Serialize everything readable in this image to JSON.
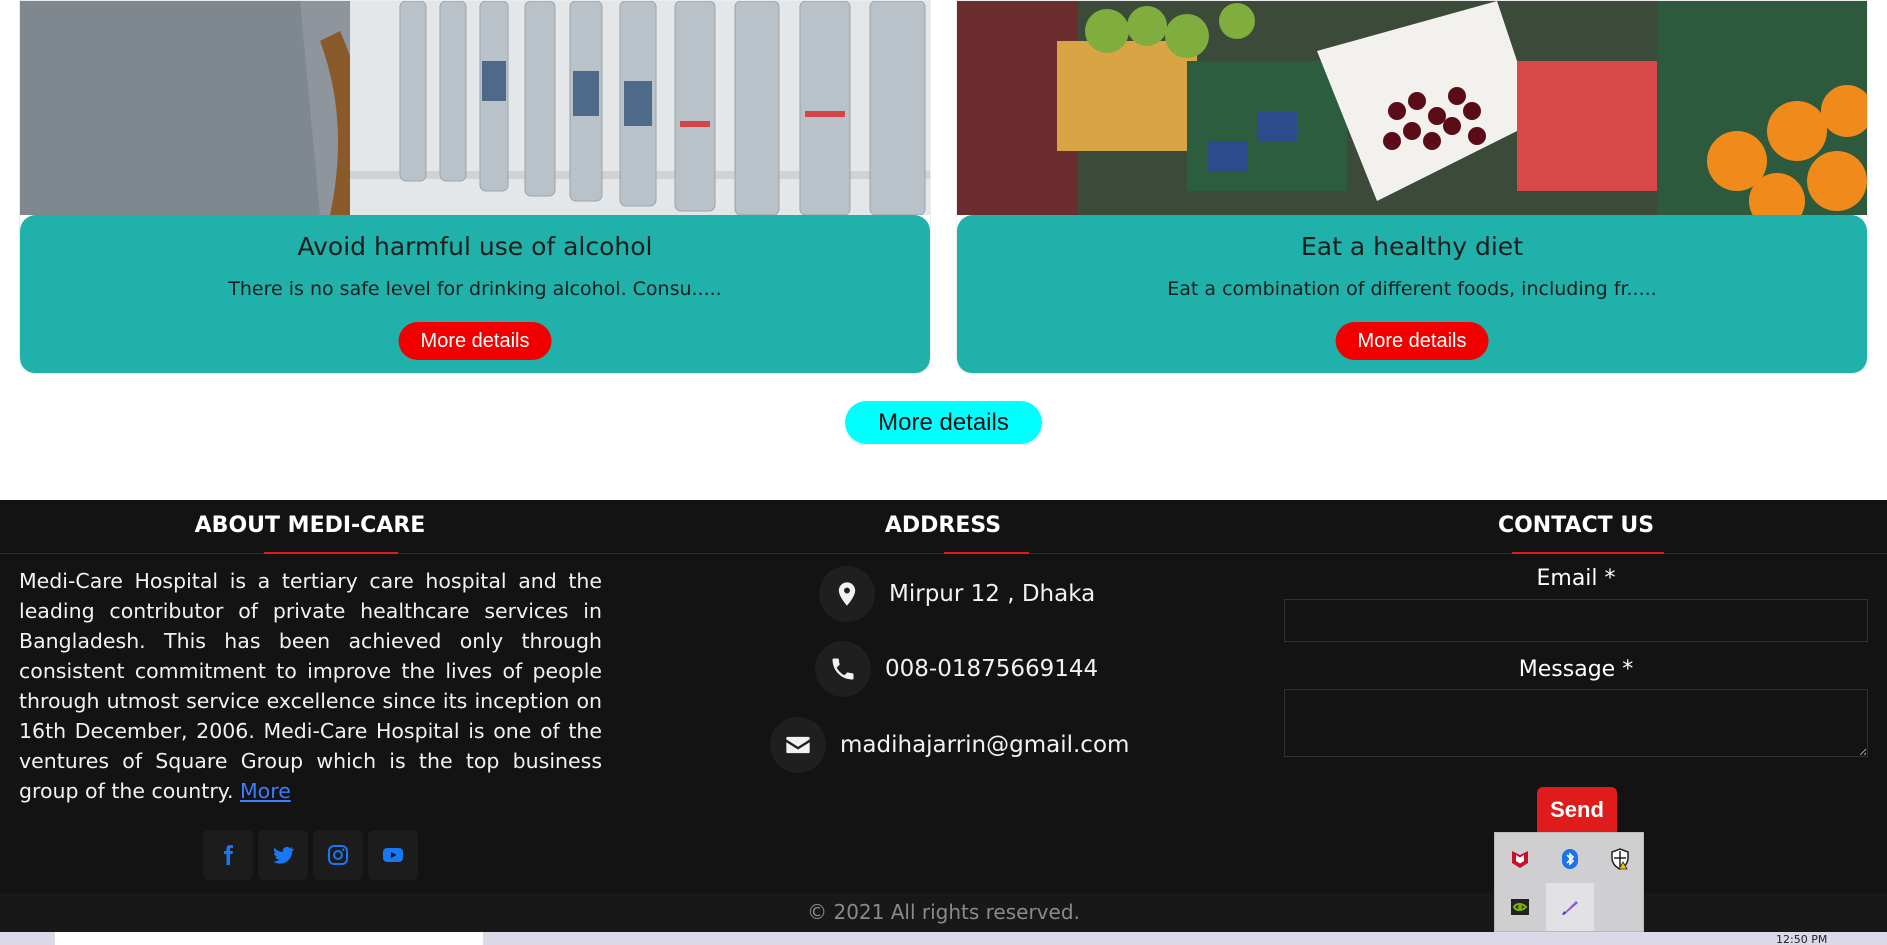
{
  "cards": [
    {
      "title": "Avoid harmful use of alcohol",
      "text": "There is no safe level for drinking alcohol. Consu.....",
      "button": "More details"
    },
    {
      "title": "Eat a healthy diet",
      "text": "Eat a combination of different foods, including fr.....",
      "button": "More details"
    }
  ],
  "more_button": "More details",
  "footer": {
    "about": {
      "heading": "ABOUT MEDI-CARE",
      "text": "Medi-Care Hospital is a tertiary care hospital and the leading contributor of private healthcare services in Bangladesh. This has been achieved only through consistent commitment to improve the lives of people through utmost service excellence since its inception on 16th December, 2006. Medi-Care Hospital is one of the ventures of Square Group which is the top business group of the country. ",
      "more_link": "More",
      "social": [
        "facebook-icon",
        "twitter-icon",
        "instagram-icon",
        "youtube-icon"
      ]
    },
    "address": {
      "heading": "ADDRESS",
      "location": "Mirpur 12 , Dhaka",
      "phone": "008-01875669144",
      "email": "madihajarrin@gmail.com"
    },
    "contact": {
      "heading": "CONTACT US",
      "email_label": "Email *",
      "message_label": "Message *",
      "send_label": "Send"
    },
    "copyright": "© 2021 All rights reserved."
  },
  "tray_icons": [
    "mcafee-icon",
    "bluetooth-icon",
    "security-shield-icon",
    "nvidia-icon",
    "pen-icon"
  ],
  "taskbar": {
    "time": "12:50 PM"
  },
  "colors": {
    "card_body": "#20b2aa",
    "card_button": "#f20000",
    "more_button": "#00ffff",
    "footer_bg": "#131313",
    "accent_red": "#e01b1b",
    "social_blue": "#1877f2"
  }
}
